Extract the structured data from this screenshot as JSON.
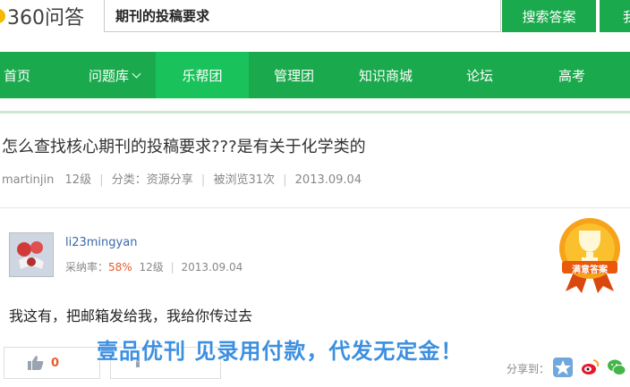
{
  "header": {
    "logo_text": "360问答",
    "search_value": "期刊的投稿要求",
    "search_button": "搜索答案",
    "ask_button": "我"
  },
  "nav": {
    "items": [
      {
        "label": "首页"
      },
      {
        "label": "问题库"
      },
      {
        "label": "乐帮团"
      },
      {
        "label": "管理团"
      },
      {
        "label": "知识商城"
      },
      {
        "label": "论坛"
      },
      {
        "label": "高考"
      }
    ]
  },
  "question": {
    "title": "怎么查找核心期刊的投稿要求???是有关于化学类的",
    "author": "martinjin",
    "level": "12级",
    "category": "分类：资源分享",
    "views": "被浏览31次",
    "date": "2013.09.04"
  },
  "answer": {
    "user": "li23mingyan",
    "rate_label": "采纳率：",
    "rate_value": "58%",
    "level": "12级",
    "date": "2013.09.04",
    "badge_text": "满意答案",
    "body": "我这有，把邮箱发给我，我给你传过去",
    "like_count": "0"
  },
  "overlay_text": "壹品优刊 见录用付款，代发无定金！",
  "share": {
    "label": "分享到："
  },
  "colors": {
    "brand_green": "#1aa94c",
    "active_green": "#19c25a",
    "accent_orange": "#e65b2e",
    "overlay_blue": "#3d8fe0"
  }
}
